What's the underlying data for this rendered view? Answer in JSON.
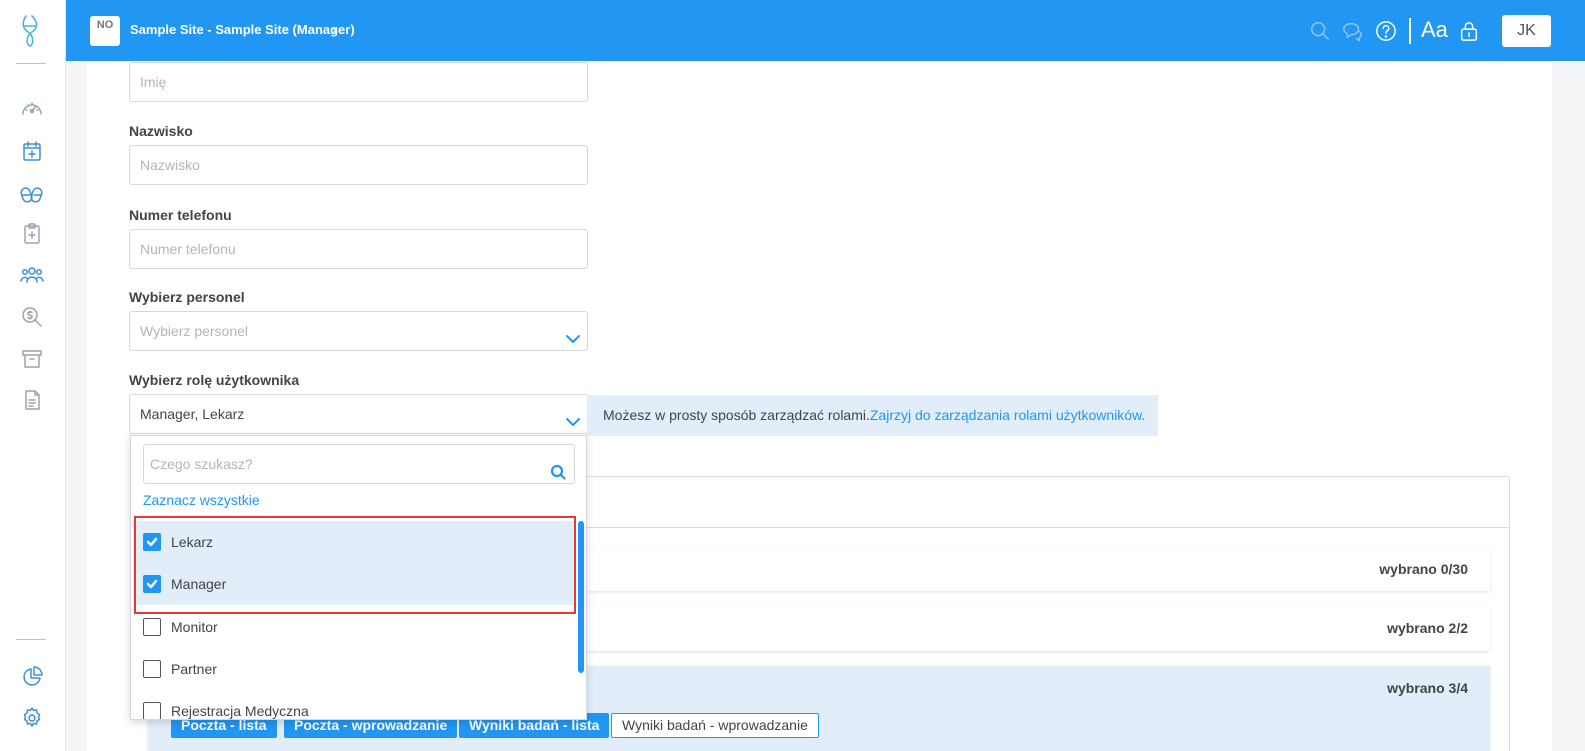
{
  "header": {
    "site_logo_text": "NO",
    "site_title": "Sample Site - Sample Site (Manager)",
    "font_toggle": "Aa",
    "user_initials": "JK"
  },
  "sidebar": {
    "icons": [
      "dashboard-icon",
      "calendar-plus-icon",
      "pills-icon",
      "clipboard-plus-icon",
      "users-icon",
      "search-dollar-icon",
      "archive-icon",
      "document-icon",
      "pie-chart-icon",
      "settings-icon"
    ]
  },
  "form": {
    "first_name_placeholder": "Imię",
    "last_name_label": "Nazwisko",
    "last_name_placeholder": "Nazwisko",
    "phone_label": "Numer telefonu",
    "phone_placeholder": "Numer telefonu",
    "staff_label": "Wybierz personel",
    "staff_placeholder": "Wybierz personel",
    "role_label": "Wybierz rolę użytkownika",
    "role_value": "Manager, Lekarz"
  },
  "info": {
    "text": "Możesz w prosty sposób zarządzać rolami.",
    "link": "Zajrzyj do zarządzania rolami użytkowników."
  },
  "dropdown": {
    "search_placeholder": "Czego szukasz?",
    "select_all": "Zaznacz wszystkie",
    "options": [
      {
        "label": "Lekarz",
        "checked": true
      },
      {
        "label": "Manager",
        "checked": true
      },
      {
        "label": "Monitor",
        "checked": false
      },
      {
        "label": "Partner",
        "checked": false
      },
      {
        "label": "Rejestracja Medyczna",
        "checked": false
      }
    ]
  },
  "permissions": {
    "rows": [
      {
        "count": "wybrano  0/30"
      },
      {
        "count": "wybrano  2/2"
      },
      {
        "count": "wybrano  3/4"
      }
    ],
    "tags": [
      {
        "label": "Poczta - lista",
        "selected": true
      },
      {
        "label": "Poczta - wprowadzanie",
        "selected": true
      },
      {
        "label": "Wyniki badań - lista",
        "selected": true
      },
      {
        "label": "Wyniki badań - wprowadzanie",
        "selected": false
      }
    ]
  },
  "colors": {
    "primary": "#2196f3",
    "highlight_border": "#e53935",
    "selected_bg": "#e1eef9"
  }
}
